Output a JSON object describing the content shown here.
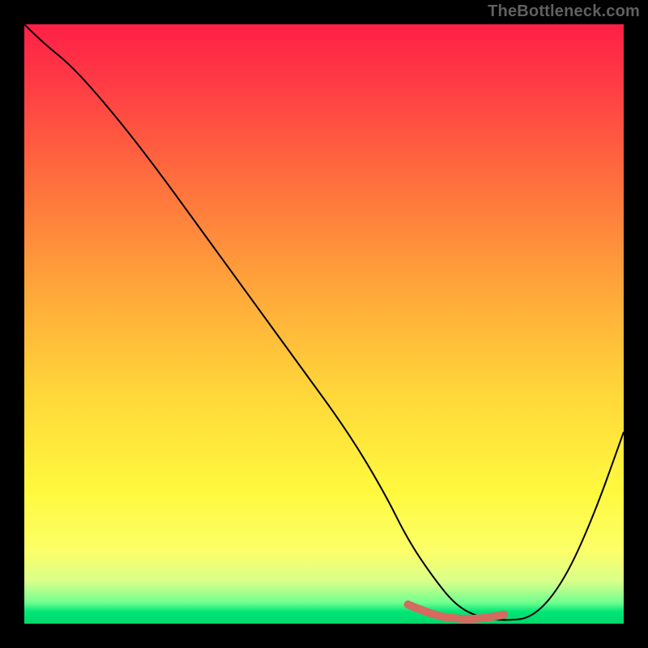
{
  "watermark": "TheBottleneck.com",
  "chart_data": {
    "type": "line",
    "title": "",
    "xlabel": "",
    "ylabel": "",
    "xlim": [
      0,
      100
    ],
    "ylim": [
      0,
      100
    ],
    "x": [
      0,
      3,
      8,
      15,
      22,
      30,
      38,
      46,
      54,
      60,
      64,
      68,
      72,
      76,
      80,
      85,
      90,
      95,
      100
    ],
    "y": [
      100,
      97,
      93,
      85,
      76,
      65,
      54,
      43,
      32,
      22,
      14,
      8,
      3,
      1,
      0.5,
      1,
      7,
      18,
      32
    ],
    "highlight_segment": {
      "x": [
        64,
        68,
        72,
        76,
        80
      ],
      "y": [
        3.2,
        1.5,
        0.8,
        0.8,
        1.5
      ]
    },
    "background_gradient": {
      "top": "#ff1f46",
      "middle": "#ffd83a",
      "bottom": "#00d86a"
    }
  }
}
